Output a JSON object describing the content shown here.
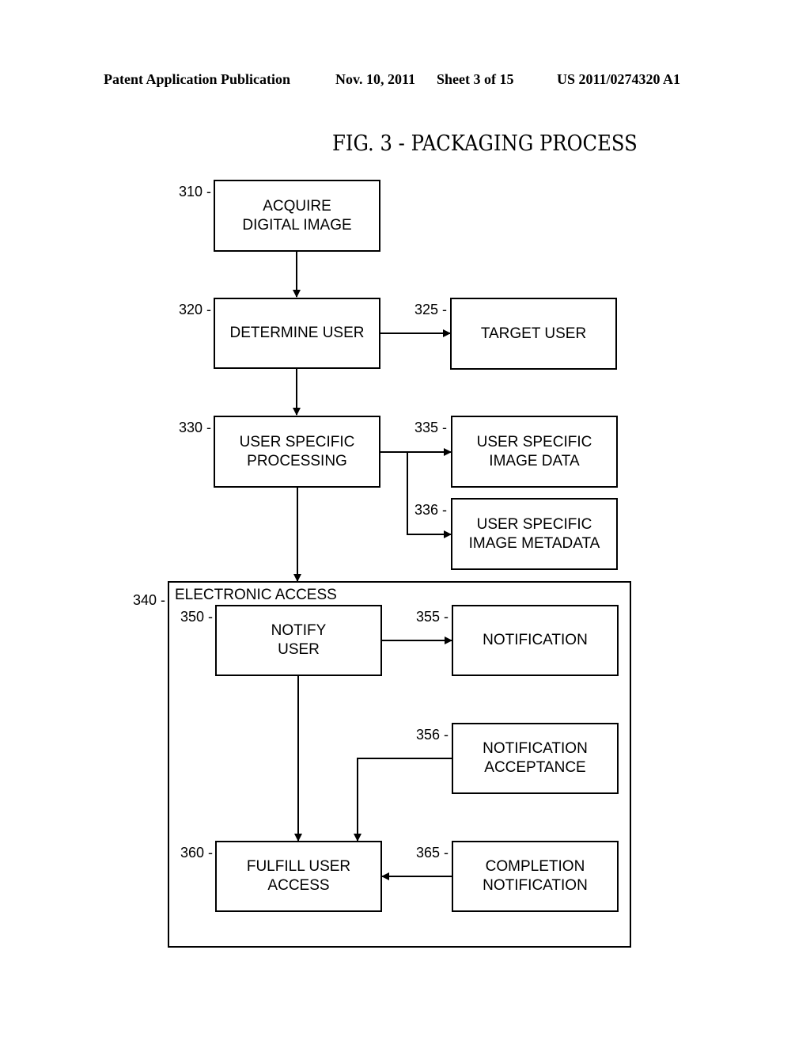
{
  "header": {
    "publication": "Patent Application Publication",
    "date": "Nov. 10, 2011",
    "sheet": "Sheet 3 of 15",
    "number": "US 2011/0274320 A1"
  },
  "figure": {
    "title": "FIG. 3 - PACKAGING PROCESS"
  },
  "nodes": {
    "n310": {
      "ref": "310 -",
      "label": "ACQUIRE\nDIGITAL IMAGE"
    },
    "n320": {
      "ref": "320 -",
      "label": "DETERMINE USER"
    },
    "n325": {
      "ref": "325 -",
      "label": "TARGET USER"
    },
    "n330": {
      "ref": "330 -",
      "label": "USER SPECIFIC\nPROCESSING"
    },
    "n335": {
      "ref": "335 -",
      "label": "USER SPECIFIC\nIMAGE DATA"
    },
    "n336": {
      "ref": "336 -",
      "label": "USER SPECIFIC\nIMAGE METADATA"
    },
    "n340": {
      "ref": "340 -",
      "label": "ELECTRONIC ACCESS"
    },
    "n350": {
      "ref": "350 -",
      "label": "NOTIFY\nUSER"
    },
    "n355": {
      "ref": "355 -",
      "label": "NOTIFICATION"
    },
    "n356": {
      "ref": "356 -",
      "label": "NOTIFICATION\nACCEPTANCE"
    },
    "n360": {
      "ref": "360 -",
      "label": "FULFILL USER\nACCESS"
    },
    "n365": {
      "ref": "365 -",
      "label": "COMPLETION\nNOTIFICATION"
    }
  },
  "edges": [
    {
      "from": "310",
      "to": "320"
    },
    {
      "from": "320",
      "to": "325"
    },
    {
      "from": "320",
      "to": "330"
    },
    {
      "from": "330",
      "to": "335"
    },
    {
      "from": "330",
      "to": "336"
    },
    {
      "from": "330",
      "to": "340"
    },
    {
      "from": "350",
      "to": "355"
    },
    {
      "from": "350",
      "to": "360"
    },
    {
      "from": "356",
      "to": "360"
    },
    {
      "from": "365",
      "to": "360"
    }
  ]
}
